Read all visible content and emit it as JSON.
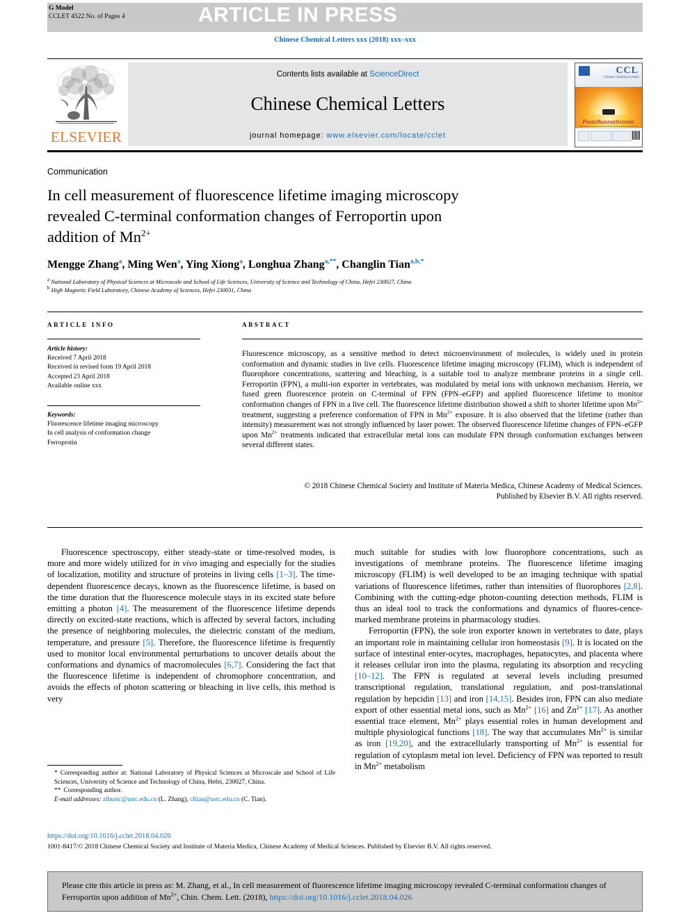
{
  "header": {
    "g_model_label": "G Model",
    "g_model_code": "CCLET 4522 No. of Pages 4",
    "article_in_press": "ARTICLE IN PRESS",
    "journal_ref": "Chinese Chemical Letters xxx (2018) xxx–xxx"
  },
  "masthead": {
    "contents_prefix": "Contents lists available at ",
    "sciencedirect": "ScienceDirect",
    "journal_title": "Chinese Chemical Letters",
    "homepage_label": "journal homepage: ",
    "homepage_url": "www.elsevier.com/locate/cclet",
    "elsevier_wordmark": "ELSEVIER",
    "cover": {
      "acronym": "CCL",
      "subtitle": "Chinese Chemical Letters",
      "feature_word": "Piezofluorochromic"
    }
  },
  "article": {
    "section_label": "Communication",
    "title_line1": "In cell measurement of fluorescence lifetime imaging microscopy",
    "title_line2": "revealed C-terminal conformation changes of Ferroportin upon",
    "title_line3_pre": "addition of Mn",
    "title_line3_sup": "2+",
    "authors_raw": "Mengge Zhang, Ming Wen, Ying Xiong, Longhua Zhang, Changlin Tian",
    "affiliation_a": "National Laboratory of Physical Sciences at Microscale and School of Life Sciences, University of Science and Technology of China, Hefei 230027, China",
    "affiliation_b": "High Magnetic Field Laboratory, Chinese Academy of Sciences, Hefei 230031, China"
  },
  "info": {
    "heading": "ARTICLE INFO",
    "history_label": "Article history:",
    "history": [
      "Received 7 April 2018",
      "Received in revised form 19 April 2018",
      "Accepted 23 April 2018",
      "Available online xxx"
    ],
    "keywords_label": "Keywords:",
    "keywords": [
      "Fluorescence lifetime imaging microscopy",
      "In cell analysis of conformation change",
      "Ferroprotin"
    ]
  },
  "abstract": {
    "heading": "ABSTRACT",
    "body": "Fluorescence microscopy, as a sensitive method to detect microenvironment of molecules, is widely used in protein conformation and dynamic studies in live cells. Fluorescence lifetime imaging microscopy (FLIM), which is independent of fluorophore concentrations, scattering and bleaching, is a suitable tool to analyze membrane proteins in a single cell. Ferroportin (FPN), a multi-ion exporter in vertebrates, was modulated by metal ions with unknown mechanism. Herein, we fused green fluorescence protein on C-terminal of FPN (FPN–eGFP) and applied fluorescence lifetime to monitor conformation changes of FPN in a live cell. The fluorescence lifetime distribution showed a shift to shorter lifetime upon Mn2+ treatment, suggesting a preference conformation of FPN in Mn2+ exposure. It is also observed that the lifetime (rather than intensity) measurement was not strongly influenced by laser power. The observed fluorescence lifetime changes of FPN–eGFP upon Mn2+ treatments indicated that extracellular metal ions can modulate FPN through conformation exchanges between several different states.",
    "copyright_line1": "© 2018 Chinese Chemical Society and Institute of Materia Medica, Chinese Academy of Medical Sciences.",
    "copyright_line2": "Published by Elsevier B.V. All rights reserved."
  },
  "body": {
    "left_paragraph": "Fluorescence spectroscopy, either steady-state or time-resolved modes, is more and more widely utilized for in vivo imaging and especially for the studies of localization, motility and structure of proteins in living cells [1–3]. The time-dependent fluorescence decays, known as the fluorescence lifetime, is based on the time duration that the fluorescence molecule stays in its excited state before emitting a photon [4]. The measurement of the fluorescence lifetime depends directly on excited-state reactions, which is affected by several factors, including the presence of neighboring molecules, the dielectric constant of the medium, temperature, and pressure [5]. Therefore, the fluorescence lifetime is frequently used to monitor local environmental perturbations to uncover details about the conformations and dynamics of macromolecules [6,7]. Considering the fact that the fluorescence lifetime is independent of chromophore concentration, and avoids the effects of photon scattering or bleaching in live cells, this method is very",
    "right_paragraph_1": "much suitable for studies with low fluorophore concentrations, such as investigations of membrane proteins. The fluorescence lifetime imaging microscopy (FLIM) is well developed to be an imaging technique with spatial variations of fluorescence lifetimes, rather than intensities of fluorophores [2,8]. Combining with the cutting-edge photon-counting detection methods, FLIM is thus an ideal tool to track the conformations and dynamics of fluorescence-marked membrane proteins in pharmacology studies.",
    "right_paragraph_2": "Ferroportin (FPN), the sole iron exporter known in vertebrates to date, plays an important role in maintaining cellular iron homeostasis [9]. It is located on the surface of intestinal enterocytes, macrophages, hepatocytes, and placenta where it releases cellular iron into the plasma, regulating its absorption and recycling [10–12]. The FPN is regulated at several levels including presumed transcriptional regulation, translational regulation, and post-translational regulation by hepcidin [13] and iron [14,15]. Besides iron, FPN can also mediate export of other essential metal ions, such as Mn2+ [16] and Zn2+ [17]. As another essential trace element, Mn2+ plays essential roles in human development and multiple physiological functions [18]. The way that accumulates Mn2+ is similar as iron [19,20], and the extracellularly transporting of Mn2+ is essential for regulation of cytoplasm metal ion level. Deficiency of FPN was reported to result in Mn2+ metabolism"
  },
  "footnotes": {
    "corr_at": "Corresponding author at: National Laboratory of Physical Sciences at Microscale and School of Life Sciences, University of Science and Technology of China, Hefei, 230027, China.",
    "corr_author": "Corresponding author.",
    "email_label": "E-mail addresses:",
    "email_1": "zlhustc@ustc.edu.cn",
    "email_1_owner": "(L. Zhang),",
    "email_2": "cltian@ustc.edu.cn",
    "email_2_owner": "(C. Tian).",
    "doi": "https://doi.org/10.1016/j.cclet.2018.04.026",
    "issn_line": "1001-8417/© 2018 Chinese Chemical Society and Institute of Materia Medica, Chinese Academy of Medical Sciences. Published by Elsevier B.V. All rights reserved."
  },
  "cite_box": {
    "text_pre": "Please cite this article in press as: M. Zhang, et al., In cell measurement of fluorescence lifetime imaging microscopy revealed C-terminal conformation changes of Ferroportin upon addition of Mn",
    "sup": "2+",
    "text_mid": ", Chin. Chem. Lett. (2018), ",
    "link": "https://doi.org/10.1016/j.cclet.2018.04.026"
  },
  "colors": {
    "link_blue": "#1a6fb5",
    "banner_grey": "#c9c9c9",
    "masthead_grey": "#e4e5e7",
    "elsevier_orange": "#e8762c"
  }
}
